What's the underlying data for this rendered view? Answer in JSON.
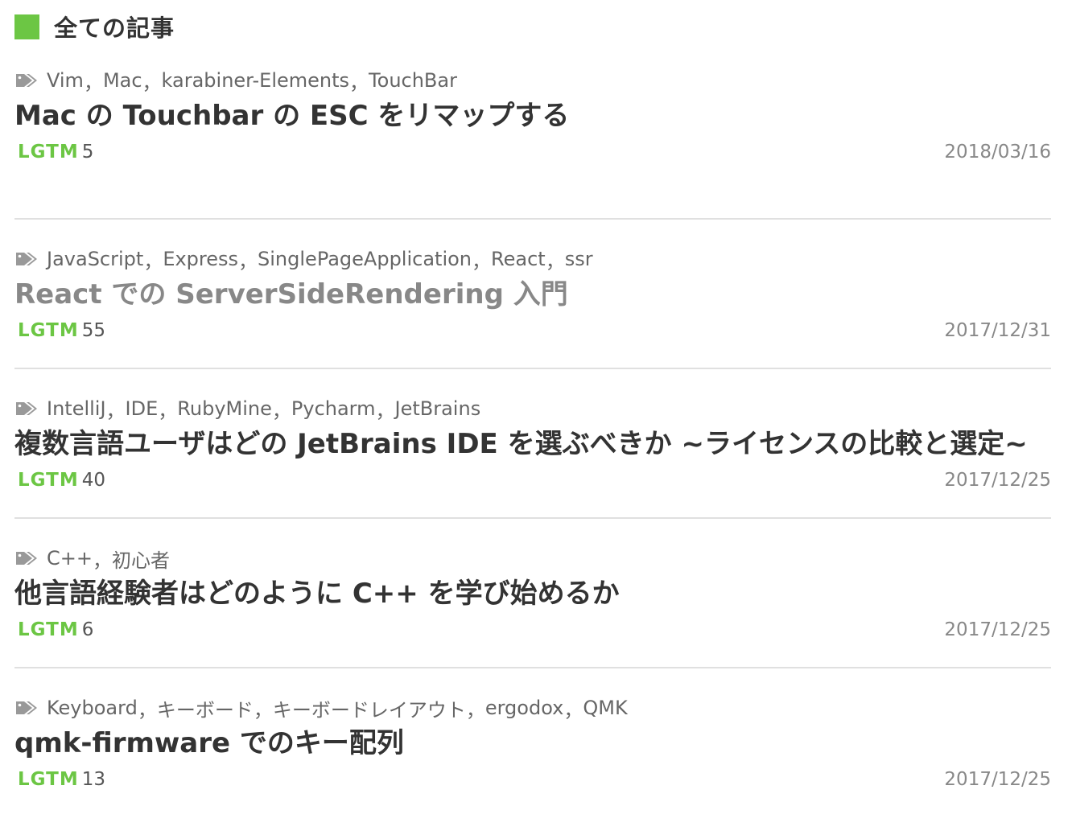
{
  "section": {
    "title": "全ての記事",
    "accent_color": "#6cc644"
  },
  "articles": [
    {
      "tags": [
        "Vim",
        "Mac",
        "karabiner-Elements",
        "TouchBar"
      ],
      "title": "Mac の Touchbar の ESC をリマップする",
      "visited": false,
      "lgtm_label": "LGTM",
      "lgtm_count": "5",
      "date": "2018/03/16"
    },
    {
      "tags": [
        "JavaScript",
        "Express",
        "SinglePageApplication",
        "React",
        "ssr"
      ],
      "title": "React での ServerSideRendering 入門",
      "visited": true,
      "lgtm_label": "LGTM",
      "lgtm_count": "55",
      "date": "2017/12/31"
    },
    {
      "tags": [
        "IntelliJ",
        "IDE",
        "RubyMine",
        "Pycharm",
        "JetBrains"
      ],
      "title": "複数言語ユーザはどの JetBrains IDE を選ぶべきか ~ライセンスの比較と選定~",
      "visited": false,
      "lgtm_label": "LGTM",
      "lgtm_count": "40",
      "date": "2017/12/25"
    },
    {
      "tags": [
        "C++",
        "初心者"
      ],
      "title": "他言語経験者はどのように C++ を学び始めるか",
      "visited": false,
      "lgtm_label": "LGTM",
      "lgtm_count": "6",
      "date": "2017/12/25"
    },
    {
      "tags": [
        "Keyboard",
        "キーボード",
        "キーボードレイアウト",
        "ergodox",
        "QMK"
      ],
      "title": "qmk-firmware でのキー配列",
      "visited": false,
      "lgtm_label": "LGTM",
      "lgtm_count": "13",
      "date": "2017/12/25"
    }
  ],
  "icons": {
    "tag": "tags-icon"
  },
  "tag_separator": "，"
}
